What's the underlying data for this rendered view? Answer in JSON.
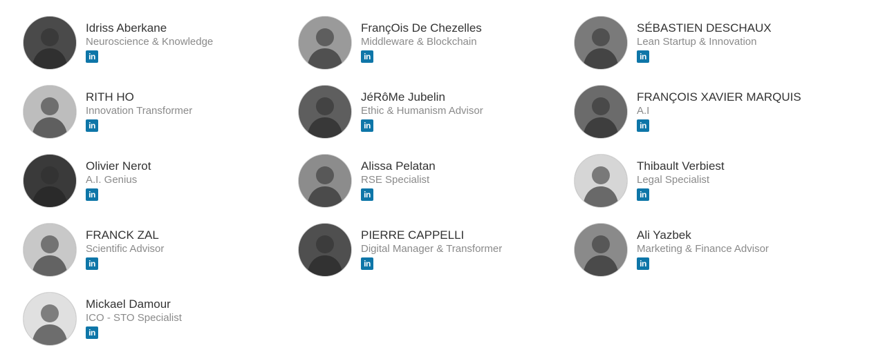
{
  "members": [
    {
      "name": "Idriss Aberkane",
      "role": "Neuroscience & Knowledge",
      "tone": "#4a4a4a",
      "link_icon": "linkedin-icon",
      "link_glyph": "in"
    },
    {
      "name": "FrançOis De Chezelles",
      "role": "Middleware & Blockchain",
      "tone": "#9a9a9a",
      "link_icon": "linkedin-icon",
      "link_glyph": "in"
    },
    {
      "name": "SÉBASTIEN DESCHAUX",
      "role": "Lean Startup & Innovation",
      "tone": "#7a7a7a",
      "link_icon": "linkedin-icon",
      "link_glyph": "in"
    },
    {
      "name": "RITH HO",
      "role": "Innovation Transformer",
      "tone": "#bdbdbd",
      "link_icon": "linkedin-icon",
      "link_glyph": "in"
    },
    {
      "name": "JéRôMe Jubelin",
      "role": "Ethic & Humanism Advisor",
      "tone": "#5e5e5e",
      "link_icon": "linkedin-icon",
      "link_glyph": "in"
    },
    {
      "name": "FRANÇOIS XAVIER MARQUIS",
      "role": "A.I",
      "tone": "#6b6b6b",
      "link_icon": "linkedin-icon",
      "link_glyph": "in"
    },
    {
      "name": "Olivier Nerot",
      "role": "A.I. Genius",
      "tone": "#3a3a3a",
      "link_icon": "linkedin-icon",
      "link_glyph": "in"
    },
    {
      "name": "Alissa Pelatan",
      "role": "RSE Specialist",
      "tone": "#8c8c8c",
      "link_icon": "linkedin-icon",
      "link_glyph": "in"
    },
    {
      "name": "Thibault Verbiest",
      "role": "Legal Specialist",
      "tone": "#d6d6d6",
      "link_icon": "linkedin-icon",
      "link_glyph": "in"
    },
    {
      "name": "FRANCK ZAL",
      "role": "Scientific Advisor",
      "tone": "#c8c8c8",
      "link_icon": "linkedin-icon",
      "link_glyph": "in"
    },
    {
      "name": "PIERRE CAPPELLI",
      "role": "Digital Manager & Transformer",
      "tone": "#4f4f4f",
      "link_icon": "linkedin-icon",
      "link_glyph": "in"
    },
    {
      "name": "Ali Yazbek",
      "role": "Marketing & Finance Advisor",
      "tone": "#8a8a8a",
      "link_icon": "linkedin-icon",
      "link_glyph": "in"
    },
    {
      "name": "Mickael Damour",
      "role": "ICO - STO Specialist",
      "tone": "#e0e0e0",
      "link_icon": "linkedin-icon",
      "link_glyph": "in"
    }
  ],
  "colors": {
    "linkedin": "#0e76a8",
    "name_text": "#333333",
    "role_text": "#8a8a8a"
  }
}
